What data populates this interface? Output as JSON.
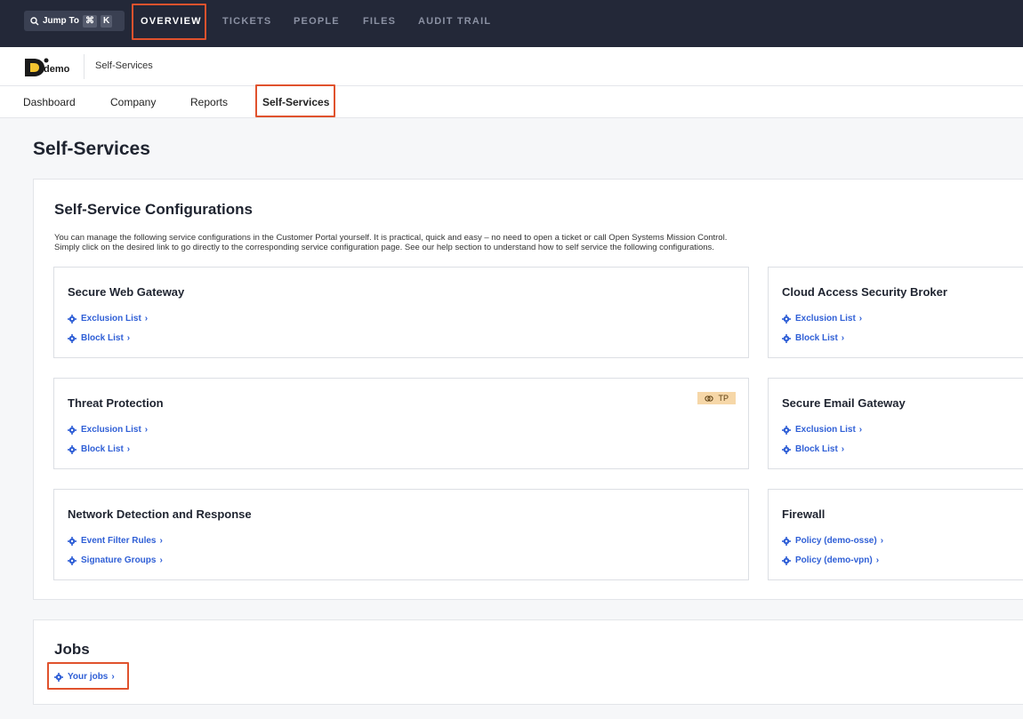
{
  "topbar": {
    "jump_label": "Jump To",
    "jump_key1": "⌘",
    "jump_key2": "K",
    "tabs": [
      "OVERVIEW",
      "TICKETS",
      "PEOPLE",
      "FILES",
      "AUDIT TRAIL"
    ]
  },
  "crumb": {
    "logo_text": "demo",
    "current": "Self-Services"
  },
  "subtabs": [
    "Dashboard",
    "Company",
    "Reports",
    "Self-Services"
  ],
  "page_title": "Self-Services",
  "config": {
    "title": "Self-Service Configurations",
    "desc_line1": "You can manage the following service configurations in the Customer Portal yourself. It is practical, quick and easy – no need to open a ticket or call Open Systems Mission Control.",
    "desc_line2": "Simply click on the desired link to go directly to the corresponding service configuration page. See our help section to understand how to self service the following configurations.",
    "cards": [
      {
        "title": "Secure Web Gateway",
        "links": [
          "Exclusion List",
          "Block List"
        ]
      },
      {
        "title": "Cloud Access Security Broker",
        "links": [
          "Exclusion List",
          "Block List"
        ]
      },
      {
        "title": "Threat Protection",
        "badge": "TP",
        "links": [
          "Exclusion List",
          "Block List"
        ]
      },
      {
        "title": "Secure Email Gateway",
        "links": [
          "Exclusion List",
          "Block List"
        ]
      },
      {
        "title": "Network Detection and Response",
        "links": [
          "Event Filter Rules",
          "Signature Groups"
        ]
      },
      {
        "title": "Firewall",
        "links": [
          "Policy (demo-osse)",
          "Policy (demo-vpn)"
        ]
      }
    ]
  },
  "jobs": {
    "title": "Jobs",
    "link": "Your jobs"
  },
  "colors": {
    "topbar_bg": "#232838",
    "link": "#2f5fd6",
    "highlight": "#e0522d",
    "badge_bg": "#f6d7a8"
  }
}
